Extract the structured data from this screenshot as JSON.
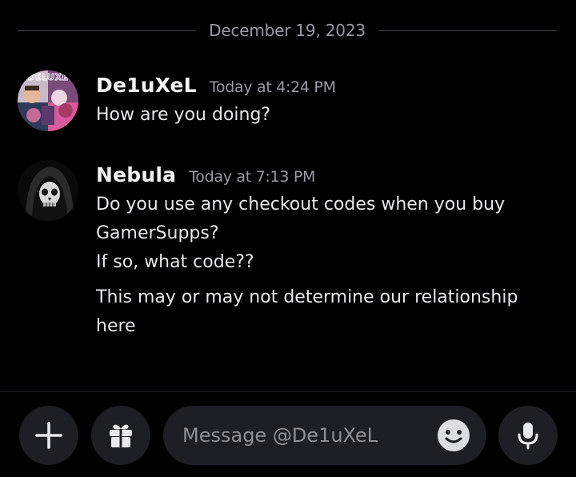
{
  "date_divider": "December 19, 2023",
  "messages": [
    {
      "author": "De1uXeL",
      "timestamp": "Today at 4:24 PM",
      "avatar_text": "DELUXE",
      "avatar_icon": "collage-avatar",
      "lines": [
        "How are you doing?"
      ]
    },
    {
      "author": "Nebula",
      "timestamp": "Today at 7:13 PM",
      "avatar_icon": "hooded-skull-avatar",
      "lines": [
        "Do you use any checkout codes when you buy",
        "GamerSupps?",
        "If so, what code??",
        "This may or may not determine our relationship",
        "here"
      ]
    }
  ],
  "composer": {
    "placeholder": "Message @De1uXeL",
    "attach_icon": "plus-icon",
    "gift_icon": "gift-icon",
    "emoji_icon": "emoji-icon",
    "voice_icon": "microphone-icon"
  },
  "colors": {
    "background": "#000000",
    "button_bg": "#1e1f24",
    "muted_text": "#9a9ba3",
    "body_text": "#e8e9ec"
  }
}
